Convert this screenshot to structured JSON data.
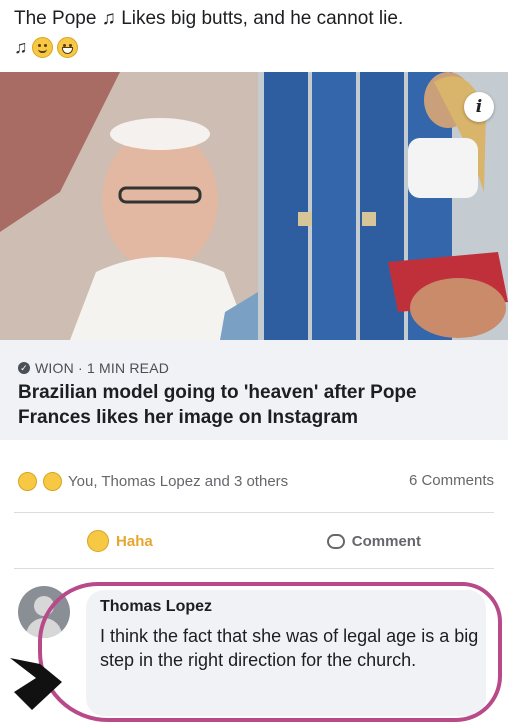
{
  "caption": {
    "text": "The Pope ♫ Likes big butts, and he cannot lie.",
    "emoji_icons": [
      "music-notes-icon",
      "upside-down-face-icon",
      "grinning-face-icon"
    ]
  },
  "photo": {
    "info_badge": "i"
  },
  "link_preview": {
    "source": "WION · 1 MIN READ",
    "headline": "Brazilian model going to 'heaven' after Pope Frances likes her image on Instagram"
  },
  "reactions": {
    "summary": "You, Thomas Lopez and 3 others",
    "comments_count": "6 Comments"
  },
  "actions": {
    "haha_label": "Haha",
    "comment_label": "Comment"
  },
  "comment": {
    "author": "Thomas Lopez",
    "text": "I think the fact that she was of legal age is a big step in the right direction for the church."
  },
  "colors": {
    "haha": "#e8a52f",
    "annotation_circle": "#b84a8a",
    "muted_text": "#65676b",
    "bubble_bg": "#f0f2f5"
  }
}
